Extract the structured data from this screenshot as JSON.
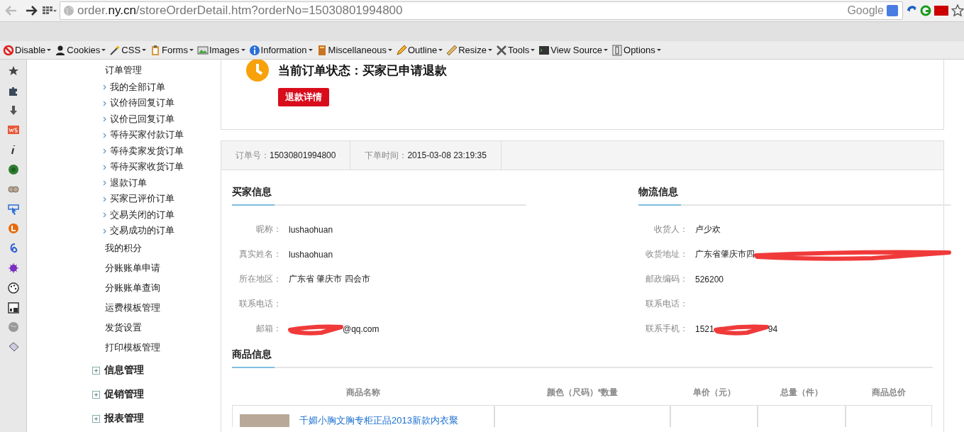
{
  "browser": {
    "url_prefix": "order.",
    "url_domain": "ny.cn",
    "url_path": "/storeOrderDetail.htm?orderNo=15030801994800",
    "search_engine": "Google"
  },
  "toolbar": [
    {
      "label": "Disable"
    },
    {
      "label": "Cookies"
    },
    {
      "label": "CSS"
    },
    {
      "label": "Forms"
    },
    {
      "label": "Images"
    },
    {
      "label": "Information"
    },
    {
      "label": "Miscellaneous"
    },
    {
      "label": "Outline"
    },
    {
      "label": "Resize"
    },
    {
      "label": "Tools"
    },
    {
      "label": "View Source"
    },
    {
      "label": "Options"
    }
  ],
  "sidebar": {
    "groups": [
      {
        "title": "订单管理",
        "children": [
          {
            "label": "我的全部订单"
          },
          {
            "label": "议价待回复订单"
          },
          {
            "label": "议价已回复订单"
          },
          {
            "label": "等待买家付款订单"
          },
          {
            "label": "等待卖家发货订单"
          },
          {
            "label": "等待买家收货订单"
          },
          {
            "label": "退款订单"
          },
          {
            "label": "买家已评价订单"
          },
          {
            "label": "交易关闭的订单"
          },
          {
            "label": "交易成功的订单"
          }
        ]
      },
      {
        "title": "我的积分"
      },
      {
        "title": "分账账单申请"
      },
      {
        "title": "分账账单查询"
      },
      {
        "title": "运费模板管理"
      },
      {
        "title": "发货设置"
      },
      {
        "title": "打印模板管理"
      }
    ],
    "sections": [
      {
        "title": "信息管理",
        "expanded": false
      },
      {
        "title": "促销管理",
        "expanded": false
      },
      {
        "title": "报表管理",
        "expanded": false
      }
    ]
  },
  "status": {
    "text": "当前订单状态：买家已申请退款",
    "button": "退款详情"
  },
  "order_bar": [
    {
      "label": "订单号：",
      "value": "15030801994800"
    },
    {
      "label": "下单时间：",
      "value": "2015-03-08 23:19:35"
    }
  ],
  "panels": [
    {
      "title": "买家信息",
      "fields": [
        {
          "label": "昵称：",
          "value": "lushaohuan"
        },
        {
          "label": "真实姓名：",
          "value": " lushaohuan"
        },
        {
          "label": "所在地区：",
          "value": "广东省 肇庆市 四会市"
        },
        {
          "label": "联系电话："
        },
        {
          "label": "邮箱：",
          "redacted": true,
          "after": "@qq.com"
        }
      ]
    },
    {
      "title": "物流信息",
      "fields": [
        {
          "label": "收货人：",
          "value": "卢少欢"
        },
        {
          "label": "收货地址：",
          "redacted": true,
          "before": "广东省肇庆市四"
        },
        {
          "label": "邮政编码：",
          "value": "526200"
        },
        {
          "label": "联系电话："
        },
        {
          "label": "联系手机：",
          "redacted": true,
          "before": "1521",
          "after": "94"
        }
      ]
    }
  ],
  "goods": {
    "title": "商品信息",
    "columns": [
      "商品名称",
      "颜色（尺码）*数量",
      "单价（元）",
      "总量（件）",
      "商品总价"
    ],
    "rows": [
      {
        "name": "千媚小胸文胸专柜正品2013新款内衣聚"
      }
    ]
  }
}
